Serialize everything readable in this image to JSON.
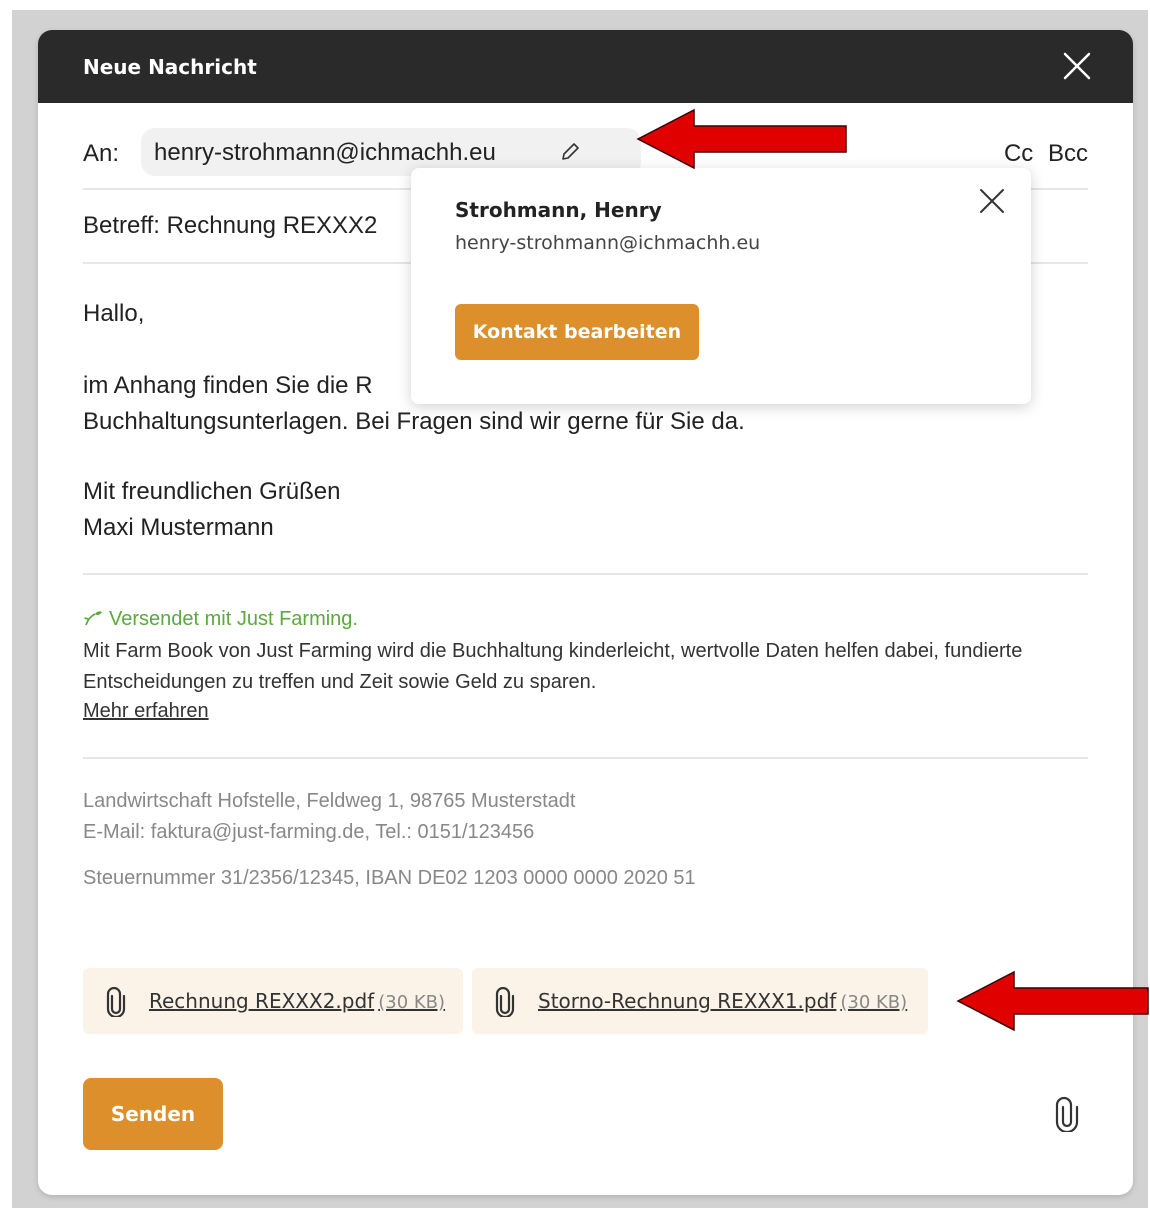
{
  "header": {
    "title": "Neue Nachricht"
  },
  "recipient": {
    "label": "An:",
    "email": "henry-strohmann@ichmachh.eu"
  },
  "cc_label": "Cc",
  "bcc_label": "Bcc",
  "subject": {
    "text": "Betreff: Rechnung REXXX2"
  },
  "popover": {
    "name": "Strohmann, Henry",
    "email": "henry-strohmann@ichmachh.eu",
    "button_label": "Kontakt bearbeiten"
  },
  "body": {
    "greeting": "Hallo,",
    "line1": "im Anhang finden Sie die R",
    "line2": "Buchhaltungsunterlagen. Bei Fragen sind wir gerne für Sie da.",
    "closing": "Mit freundlichen Grüßen",
    "signature": "Maxi Mustermann"
  },
  "promo": {
    "tagline": "Versendet mit Just Farming.",
    "text": "Mit Farm Book von Just Farming wird die Buchhaltung kinderleicht, wertvolle Daten helfen dabei, fundierte Entscheidungen zu treffen und Zeit sowie Geld zu sparen.",
    "link": "Mehr erfahren"
  },
  "footer": {
    "address": "Landwirtschaft Hofstelle, Feldweg 1, 98765 Musterstadt",
    "contact": "E-Mail: faktura@just-farming.de, Tel.: 0151/123456",
    "tax": "Steuernummer 31/2356/12345, IBAN DE02 1203 0000 0000 2020 51"
  },
  "attachments": [
    {
      "name": "Rechnung REXXX2.pdf",
      "size": "(30 KB)"
    },
    {
      "name": "Storno-Rechnung REXXX1.pdf",
      "size": "(30 KB)"
    }
  ],
  "send_label": "Senden",
  "colors": {
    "accent": "#dc8f2b",
    "header_bg": "#2a2a2a",
    "promo_green": "#5aaa3c",
    "annotation_arrow": "#e00000"
  }
}
